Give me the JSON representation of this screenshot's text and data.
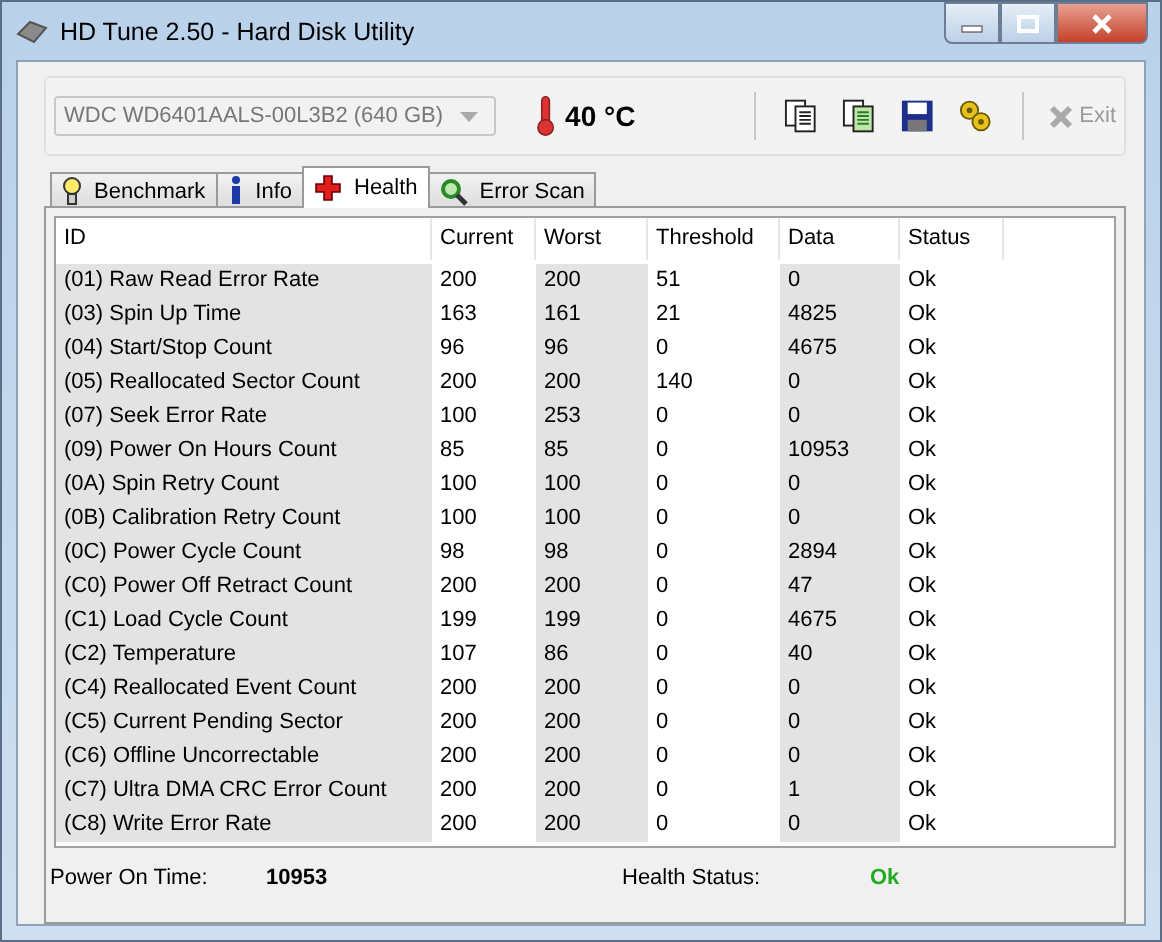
{
  "window": {
    "title": "HD Tune 2.50 - Hard Disk Utility"
  },
  "toolbar": {
    "drive": "WDC WD6401AALS-00L3B2 (640 GB)",
    "temperature": "40 °C",
    "exit": {
      "label": "Exit",
      "disabled": true
    }
  },
  "tabs": [
    {
      "label": "Benchmark",
      "selected": false,
      "kind": "bulb"
    },
    {
      "label": "Info",
      "selected": false,
      "kind": "info"
    },
    {
      "label": "Health",
      "selected": true,
      "kind": "cross"
    },
    {
      "label": "Error Scan",
      "selected": false,
      "kind": "magnifier"
    }
  ],
  "table": {
    "columns": [
      "ID",
      "Current",
      "Worst",
      "Threshold",
      "Data",
      "Status"
    ],
    "rows": [
      [
        "(01) Raw Read Error Rate",
        "200",
        "200",
        "51",
        "0",
        "Ok"
      ],
      [
        "(03) Spin Up Time",
        "163",
        "161",
        "21",
        "4825",
        "Ok"
      ],
      [
        "(04) Start/Stop Count",
        "96",
        "96",
        "0",
        "4675",
        "Ok"
      ],
      [
        "(05) Reallocated Sector Count",
        "200",
        "200",
        "140",
        "0",
        "Ok"
      ],
      [
        "(07) Seek Error Rate",
        "100",
        "253",
        "0",
        "0",
        "Ok"
      ],
      [
        "(09) Power On Hours Count",
        "85",
        "85",
        "0",
        "10953",
        "Ok"
      ],
      [
        "(0A) Spin Retry Count",
        "100",
        "100",
        "0",
        "0",
        "Ok"
      ],
      [
        "(0B) Calibration Retry Count",
        "100",
        "100",
        "0",
        "0",
        "Ok"
      ],
      [
        "(0C) Power Cycle Count",
        "98",
        "98",
        "0",
        "2894",
        "Ok"
      ],
      [
        "(C0) Power Off Retract Count",
        "200",
        "200",
        "0",
        "47",
        "Ok"
      ],
      [
        "(C1) Load Cycle Count",
        "199",
        "199",
        "0",
        "4675",
        "Ok"
      ],
      [
        "(C2) Temperature",
        "107",
        "86",
        "0",
        "40",
        "Ok"
      ],
      [
        "(C4) Reallocated Event Count",
        "200",
        "200",
        "0",
        "0",
        "Ok"
      ],
      [
        "(C5) Current Pending Sector",
        "200",
        "200",
        "0",
        "0",
        "Ok"
      ],
      [
        "(C6) Offline Uncorrectable",
        "200",
        "200",
        "0",
        "0",
        "Ok"
      ],
      [
        "(C7) Ultra DMA CRC Error Count",
        "200",
        "200",
        "0",
        "1",
        "Ok"
      ],
      [
        "(C8) Write Error Rate",
        "200",
        "200",
        "0",
        "0",
        "Ok"
      ]
    ]
  },
  "footer": {
    "power_on_label": "Power On Time:",
    "power_on_value": "10953",
    "health_label": "Health Status:",
    "health_value": "Ok",
    "healthy": true
  }
}
